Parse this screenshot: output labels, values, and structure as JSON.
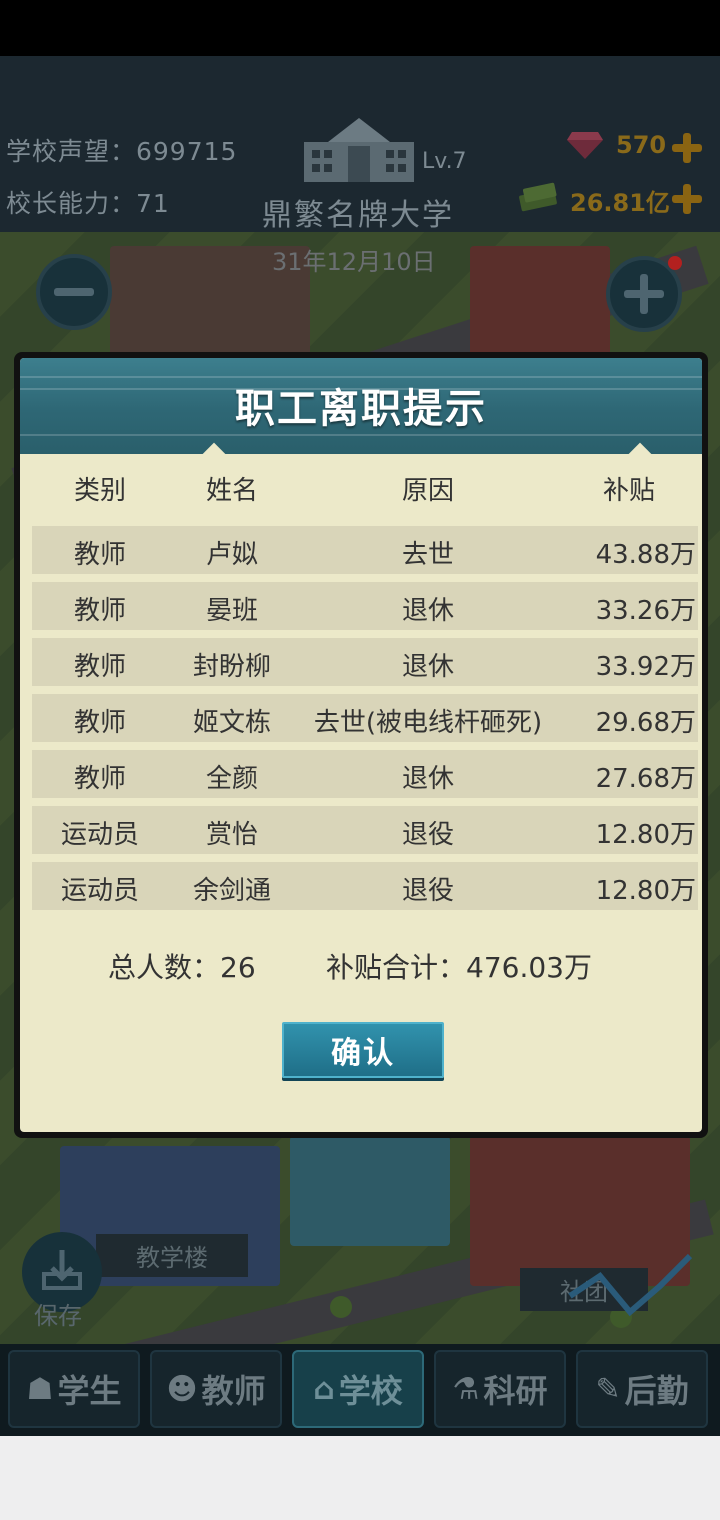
{
  "header": {
    "reputation_label": "学校声望：699715",
    "ability_label": "校长能力：71",
    "level": "Lv.7",
    "school_name": "鼎繁名牌大学",
    "gems": "570",
    "money": "26.81亿",
    "date": "31年12月10日"
  },
  "map": {
    "teaching_building": "教学楼",
    "community": "社团",
    "save": "保存"
  },
  "nav": {
    "students": "学生",
    "teachers": "教师",
    "school": "学校",
    "research": "科研",
    "logistics": "后勤"
  },
  "modal": {
    "title": "职工离职提示",
    "columns": [
      "类别",
      "姓名",
      "原因",
      "补贴"
    ],
    "rows": [
      {
        "type": "教师",
        "name": "卢姒",
        "reason": "去世",
        "subsidy": "43.88万"
      },
      {
        "type": "教师",
        "name": "晏班",
        "reason": "退休",
        "subsidy": "33.26万"
      },
      {
        "type": "教师",
        "name": "封盼柳",
        "reason": "退休",
        "subsidy": "33.92万"
      },
      {
        "type": "教师",
        "name": "姬文栋",
        "reason": "去世(被电线杆砸死)",
        "subsidy": "29.68万"
      },
      {
        "type": "教师",
        "name": "全颜",
        "reason": "退休",
        "subsidy": "27.68万"
      },
      {
        "type": "运动员",
        "name": "赏怡",
        "reason": "退役",
        "subsidy": "12.80万"
      },
      {
        "type": "运动员",
        "name": "余剑通",
        "reason": "退役",
        "subsidy": "12.80万"
      }
    ],
    "total_people": "总人数：26",
    "total_subsidy": "补贴合计：476.03万",
    "confirm": "确认"
  },
  "colors": {
    "banner": "#2e6775",
    "panel": "#ece9c9",
    "row": "#d9d5b9",
    "confirm": "#1f6f88"
  }
}
